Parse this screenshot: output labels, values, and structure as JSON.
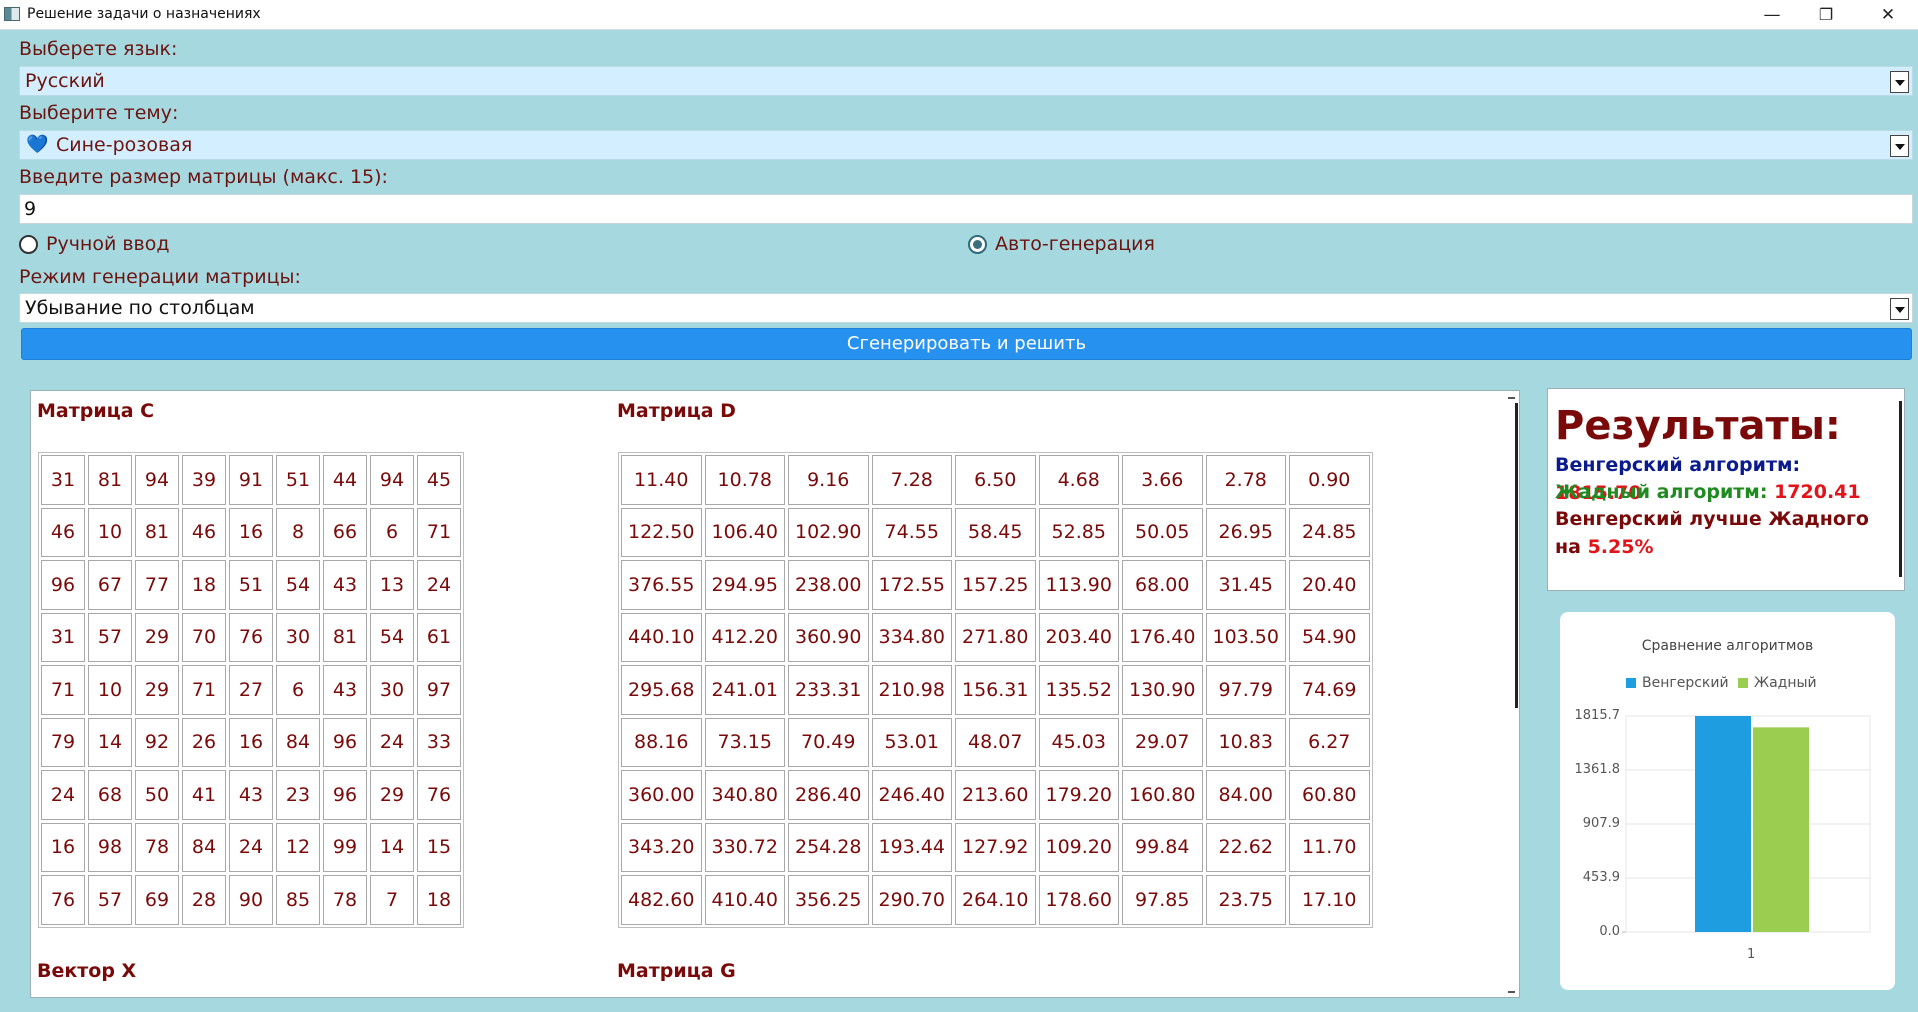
{
  "window": {
    "title": "Решение задачи о назначениях",
    "minimize_icon": "—",
    "restore_icon": "❐",
    "close_icon": "✕"
  },
  "form": {
    "language_label": "Выберете язык:",
    "language_value": "Русский",
    "theme_label": "Выберите тему:",
    "theme_emoji": "💙",
    "theme_value": "Сине-розовая",
    "size_label": "Введите размер матрицы (макс. 15):",
    "size_value": "9",
    "manual_label": "Ручной ввод",
    "auto_label": "Авто-генерация",
    "selected_mode": "auto",
    "gen_mode_label": "Режим генерации матрицы:",
    "gen_mode_value": "Убывание по столбцам",
    "generate_button": "Сгенерировать и решить"
  },
  "matrices": {
    "c_title": "Матрица C",
    "d_title": "Матрица D",
    "x_title": "Вектор X",
    "g_title": "Матрица G",
    "c": [
      [
        "31",
        "81",
        "94",
        "39",
        "91",
        "51",
        "44",
        "94",
        "45"
      ],
      [
        "46",
        "10",
        "81",
        "46",
        "16",
        "8",
        "66",
        "6",
        "71"
      ],
      [
        "96",
        "67",
        "77",
        "18",
        "51",
        "54",
        "43",
        "13",
        "24"
      ],
      [
        "31",
        "57",
        "29",
        "70",
        "76",
        "30",
        "81",
        "54",
        "61"
      ],
      [
        "71",
        "10",
        "29",
        "71",
        "27",
        "6",
        "43",
        "30",
        "97"
      ],
      [
        "79",
        "14",
        "92",
        "26",
        "16",
        "84",
        "96",
        "24",
        "33"
      ],
      [
        "24",
        "68",
        "50",
        "41",
        "43",
        "23",
        "96",
        "29",
        "76"
      ],
      [
        "16",
        "98",
        "78",
        "84",
        "24",
        "12",
        "99",
        "14",
        "15"
      ],
      [
        "76",
        "57",
        "69",
        "28",
        "90",
        "85",
        "78",
        "7",
        "18"
      ]
    ],
    "d": [
      [
        "11.40",
        "10.78",
        "9.16",
        "7.28",
        "6.50",
        "4.68",
        "3.66",
        "2.78",
        "0.90"
      ],
      [
        "122.50",
        "106.40",
        "102.90",
        "74.55",
        "58.45",
        "52.85",
        "50.05",
        "26.95",
        "24.85"
      ],
      [
        "376.55",
        "294.95",
        "238.00",
        "172.55",
        "157.25",
        "113.90",
        "68.00",
        "31.45",
        "20.40"
      ],
      [
        "440.10",
        "412.20",
        "360.90",
        "334.80",
        "271.80",
        "203.40",
        "176.40",
        "103.50",
        "54.90"
      ],
      [
        "295.68",
        "241.01",
        "233.31",
        "210.98",
        "156.31",
        "135.52",
        "130.90",
        "97.79",
        "74.69"
      ],
      [
        "88.16",
        "73.15",
        "70.49",
        "53.01",
        "48.07",
        "45.03",
        "29.07",
        "10.83",
        "6.27"
      ],
      [
        "360.00",
        "340.80",
        "286.40",
        "246.40",
        "213.60",
        "179.20",
        "160.80",
        "84.00",
        "60.80"
      ],
      [
        "343.20",
        "330.72",
        "254.28",
        "193.44",
        "127.92",
        "109.20",
        "99.84",
        "22.62",
        "11.70"
      ],
      [
        "482.60",
        "410.40",
        "356.25",
        "290.70",
        "264.10",
        "178.60",
        "97.85",
        "23.75",
        "17.10"
      ]
    ]
  },
  "results": {
    "title": "Результаты:",
    "hungarian_label": "Венгерский алгоритм:",
    "hungarian_value": "1815.70",
    "greedy_label": "Жадный алгоритм:",
    "greedy_value": "1720.41",
    "comparison_label": "Венгерский лучше Жадного на",
    "comparison_value": "5.25%",
    "hungarian_color": "#0b1a8c",
    "greedy_color": "#1f8a1f",
    "comparison_color": "#7a0a0a"
  },
  "chart_data": {
    "type": "bar",
    "title": "Сравнение алгоритмов",
    "categories": [
      "1"
    ],
    "series": [
      {
        "name": "Венгерский",
        "values": [
          1815.7
        ],
        "color": "#1e9ee0"
      },
      {
        "name": "Жадный",
        "values": [
          1720.41
        ],
        "color": "#9acd50"
      }
    ],
    "y_ticks": [
      "1815.7",
      "1361.8",
      "907.9",
      "453.9",
      "0.0"
    ],
    "ylim": [
      0,
      1815.7
    ],
    "legend": "top",
    "grid": true
  }
}
